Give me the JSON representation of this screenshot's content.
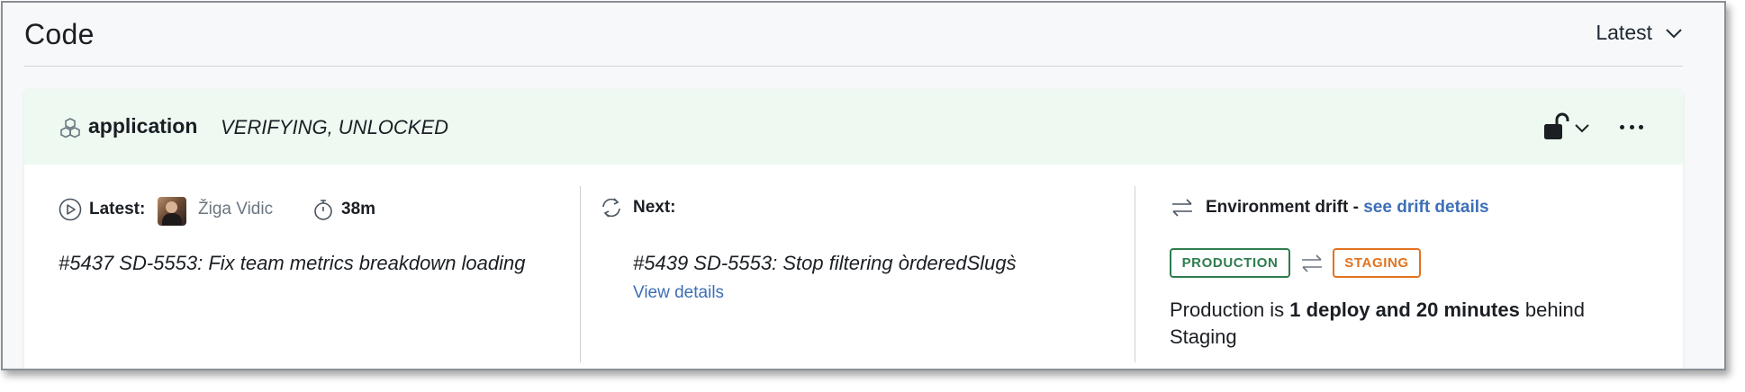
{
  "header": {
    "title": "Code",
    "version_dropdown": {
      "selected": "Latest",
      "icon": "chevron-down-icon"
    }
  },
  "app": {
    "name": "application",
    "status": "VERIFYING, UNLOCKED",
    "icon": "cubes-icon",
    "lock_icon": "unlocked-padlock-icon",
    "more_icon": "more-horizontal-icon",
    "header_bg": "#eefaf1"
  },
  "latest": {
    "label": "Latest:",
    "author": "Žiga Vidic",
    "duration": "38m",
    "commit": "#5437 SD-5553: Fix team metrics breakdown loading"
  },
  "next": {
    "label": "Next:",
    "commit": "#5439 SD-5553: Stop filtering òrderedSlugs̀",
    "link": "View details"
  },
  "drift": {
    "title": "Environment drift - ",
    "link": "see drift details",
    "from_env": "PRODUCTION",
    "to_env": "STAGING",
    "from_color": "#2e7d4f",
    "to_color": "#e2731f",
    "desc_prefix": "Production is ",
    "desc_bold": "1 deploy and 20 minutes",
    "desc_suffix": " behind Staging",
    "link_color": "#3d6fb6"
  }
}
